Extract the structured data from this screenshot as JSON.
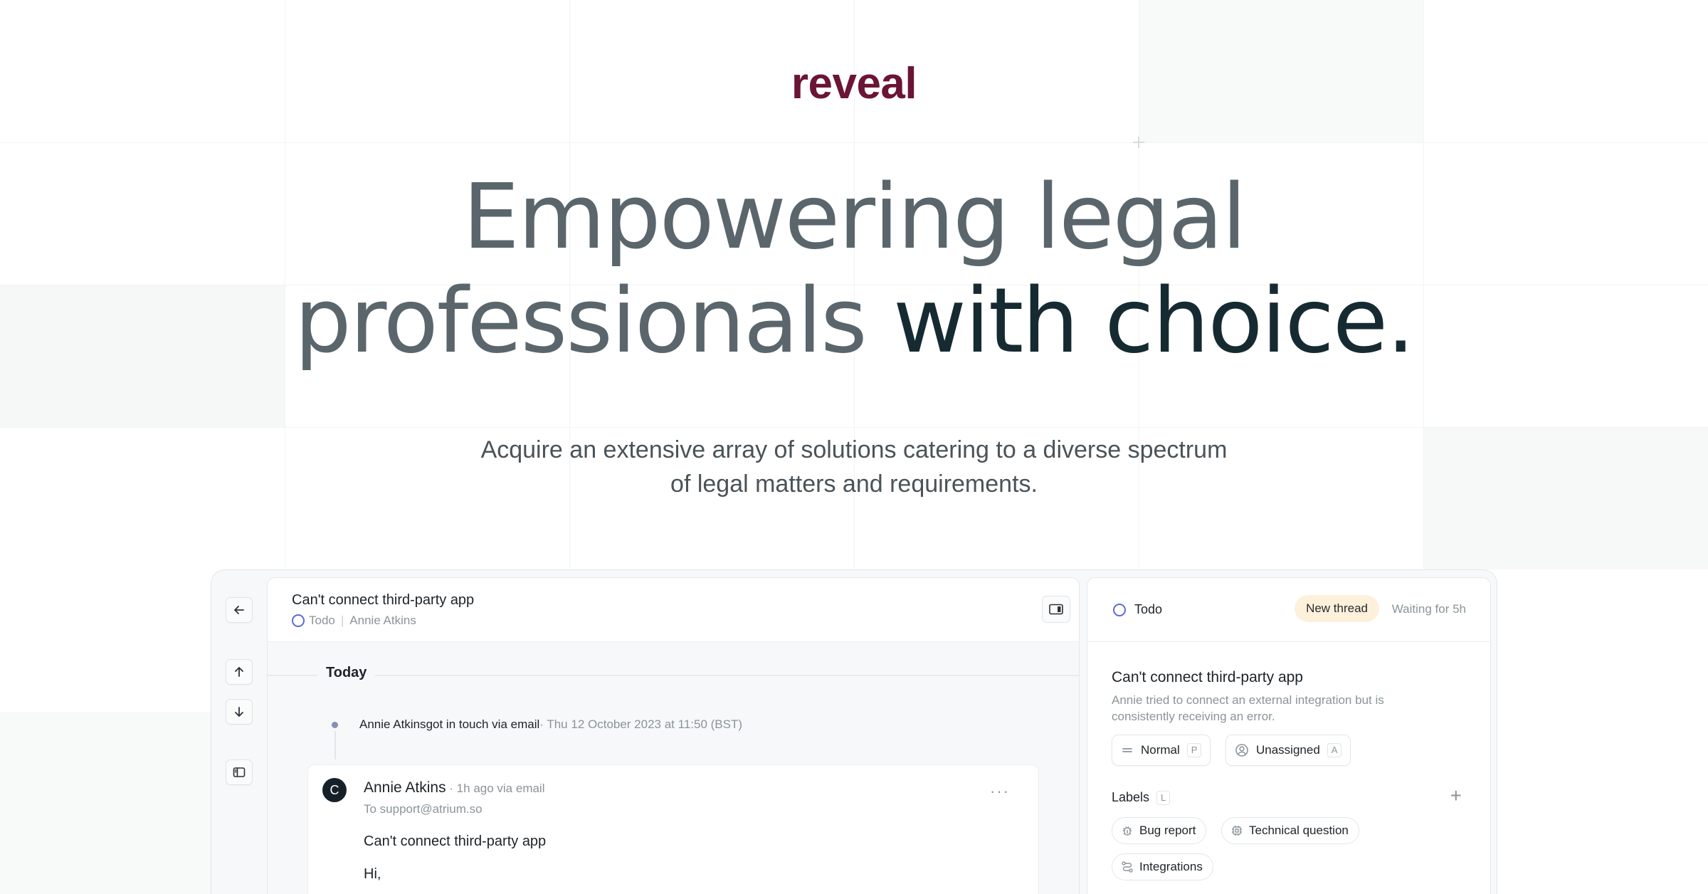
{
  "brand": {
    "logo": "reveal",
    "color": "#6b1536"
  },
  "hero": {
    "headline_light_1": "Empowering legal",
    "headline_light_2": "professionals ",
    "headline_dark": "with choice.",
    "subhead_line1": "Acquire an extensive array of solutions catering to a diverse spectrum",
    "subhead_line2": "of legal matters and requirements."
  },
  "rail": {
    "back_icon": "arrow-left-icon",
    "up_icon": "arrow-up-icon",
    "down_icon": "arrow-down-icon",
    "sidebar_icon": "sidebar-icon"
  },
  "thread": {
    "title": "Can't connect third-party app",
    "status": "Todo",
    "assignee": "Annie Atkins",
    "day_label": "Today",
    "event": {
      "actor": "Annie Atkins",
      "action": " got in touch via email",
      "timestamp": " · Thu 12 October 2023 at 11:50 (BST)"
    },
    "message": {
      "avatar_initial": "C",
      "from": "Annie Atkins",
      "meta": " · 1h ago via email",
      "to": "To support@atrium.so",
      "subject": "Can't connect third-party app",
      "body": "Hi,",
      "more": "···"
    }
  },
  "side_panel": {
    "status": "Todo",
    "badge": "New thread",
    "waiting": "Waiting for 5h",
    "title": "Can't connect third-party app",
    "description": "Annie tried to connect an external integration but is consistently receiving an error.",
    "priority": {
      "label": "Normal",
      "shortcut": "P"
    },
    "assignee": {
      "label": "Unassigned",
      "shortcut": "A"
    },
    "labels_heading": "Labels",
    "labels_shortcut": "L",
    "add_label": "+",
    "tags": [
      "Bug report",
      "Technical question",
      "Integrations"
    ]
  },
  "colors": {
    "todo_ring": "#5a6ad8",
    "badge_bg": "#fdf1dc",
    "headline_light": "#5a666c",
    "headline_dark": "#162a31"
  }
}
